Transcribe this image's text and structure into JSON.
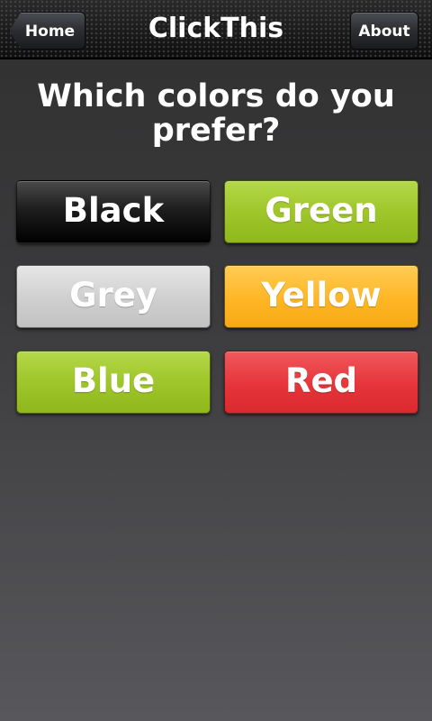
{
  "header": {
    "title": "ClickThis",
    "home_label": "Home",
    "about_label": "About"
  },
  "main": {
    "question": "Which colors do you prefer?",
    "options": [
      {
        "label": "Black",
        "color": "#000000"
      },
      {
        "label": "Green",
        "color": "#9fc62a"
      },
      {
        "label": "Grey",
        "color": "#cfcfcf"
      },
      {
        "label": "Yellow",
        "color": "#ffb625"
      },
      {
        "label": "Blue",
        "color": "#9fc62a"
      },
      {
        "label": "Red",
        "color": "#e6353a"
      }
    ]
  }
}
